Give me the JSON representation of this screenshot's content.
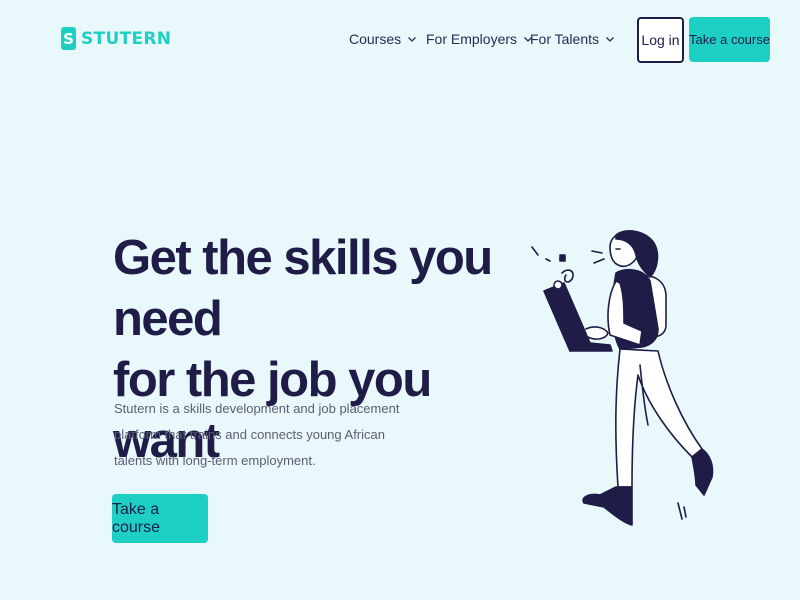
{
  "brand": {
    "logo_letter": "S",
    "name": "STUTERN",
    "color": "#1ecfc4"
  },
  "nav": {
    "items": [
      {
        "label": "Courses",
        "icon": "chevron-down-icon"
      },
      {
        "label": "For Employers",
        "icon": "chevron-down-icon"
      },
      {
        "label": "For Talents",
        "icon": "chevron-down-icon"
      }
    ],
    "login_label": "Log in",
    "cta_label": "Take a course"
  },
  "hero": {
    "title_line1": "Get the skills you need",
    "title_line2": "for the job you want",
    "description": "Stutern is a skills development and job placement platform that trains and connects young African talents with long-term employment.",
    "cta_label": "Take a course",
    "illustration": "person-walking-with-laptop"
  },
  "colors": {
    "background": "#e8f8fb",
    "accent": "#1ecfc4",
    "text_dark": "#1f1d47"
  }
}
